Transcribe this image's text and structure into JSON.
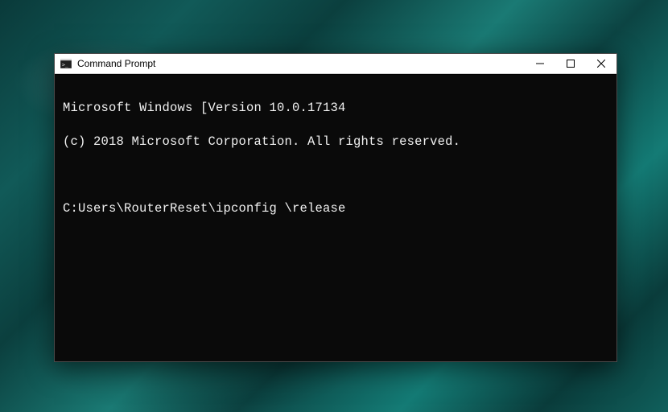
{
  "window": {
    "title": "Command Prompt"
  },
  "terminal": {
    "line1": "Microsoft Windows [Version 10.0.17134",
    "line2": "(c) 2018 Microsoft Corporation. All rights reserved.",
    "prompt": "C:Users\\RouterReset\\ipconfig \\release"
  }
}
